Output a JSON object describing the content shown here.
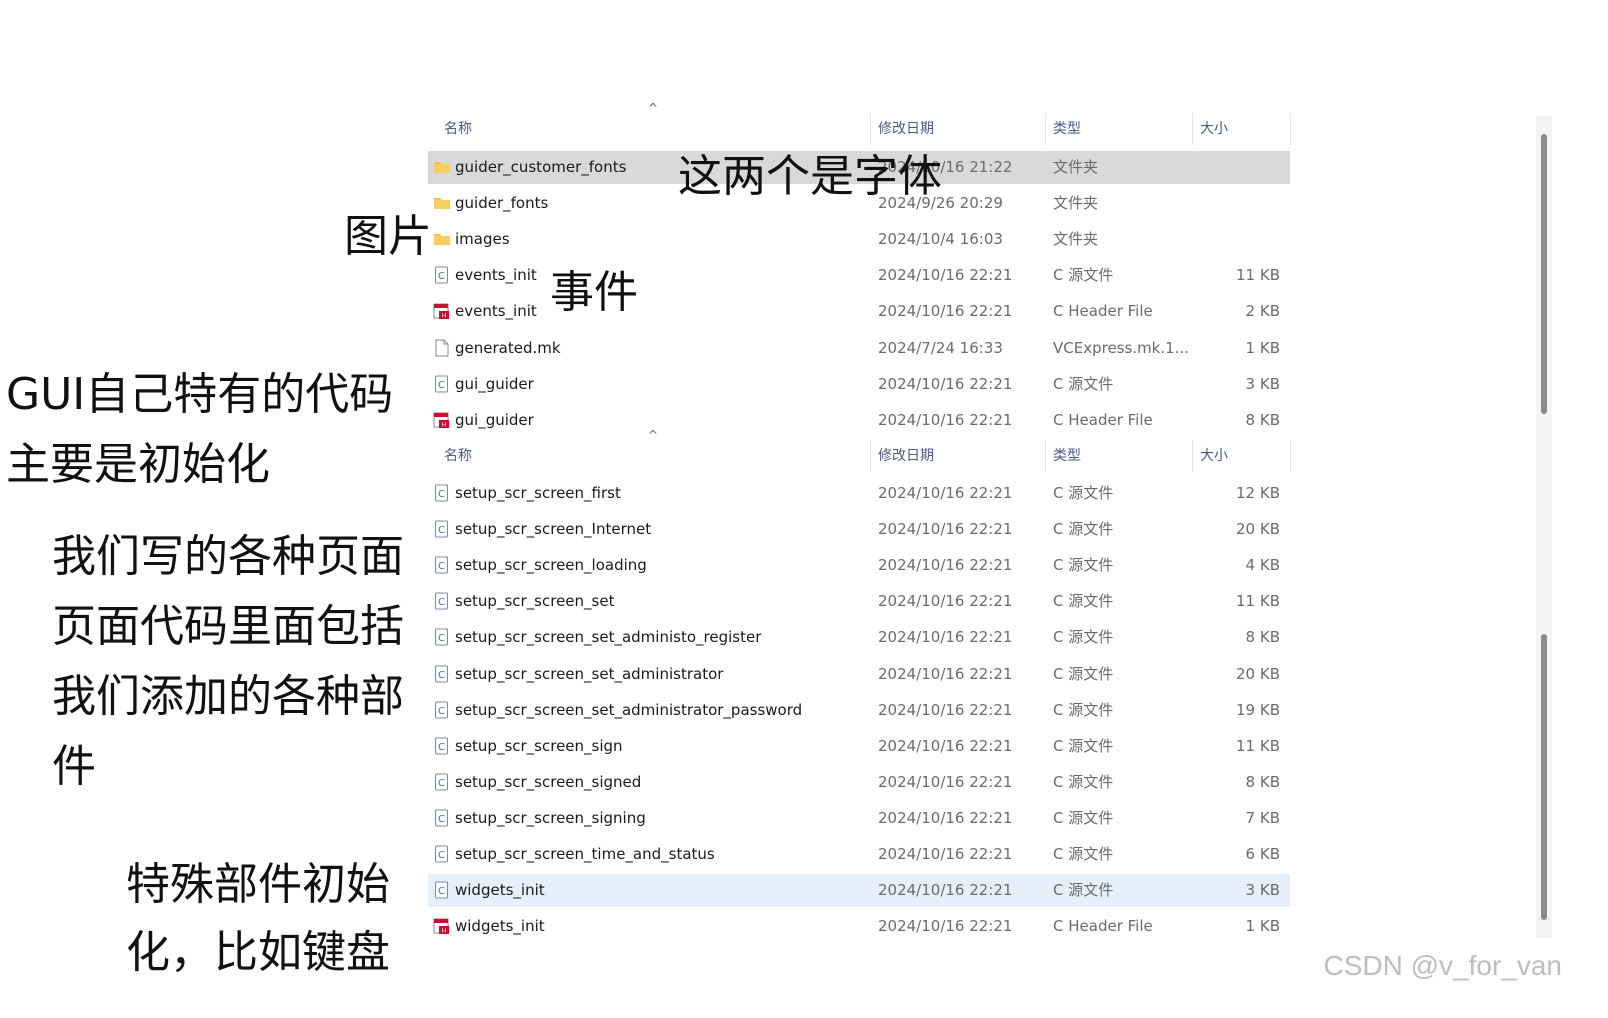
{
  "header": {
    "col_name": "名称",
    "col_date": "修改日期",
    "col_type": "类型",
    "col_size": "大小",
    "sort_caret": "^"
  },
  "files_top": [
    {
      "name": "guider_customer_fonts",
      "date": "2024/10/16 21:22",
      "type": "文件夹",
      "size": "",
      "icon": "folder-icon",
      "state": "selected"
    },
    {
      "name": "guider_fonts",
      "date": "2024/9/26 20:29",
      "type": "文件夹",
      "size": "",
      "icon": "folder-icon"
    },
    {
      "name": "images",
      "date": "2024/10/4 16:03",
      "type": "文件夹",
      "size": "",
      "icon": "folder-icon"
    },
    {
      "name": "events_init",
      "date": "2024/10/16 22:21",
      "type": "C 源文件",
      "size": "11 KB",
      "icon": "c-source-file-icon"
    },
    {
      "name": "events_init",
      "date": "2024/10/16 22:21",
      "type": "C Header File",
      "size": "2 KB",
      "icon": "c-header-file-icon"
    },
    {
      "name": "generated.mk",
      "date": "2024/7/24 16:33",
      "type": "VCExpress.mk.1...",
      "size": "1 KB",
      "icon": "blank-file-icon"
    },
    {
      "name": "gui_guider",
      "date": "2024/10/16 22:21",
      "type": "C 源文件",
      "size": "3 KB",
      "icon": "c-source-file-icon"
    },
    {
      "name": "gui_guider",
      "date": "2024/10/16 22:21",
      "type": "C Header File",
      "size": "8 KB",
      "icon": "c-header-file-icon"
    }
  ],
  "files_bottom": [
    {
      "name": "setup_scr_screen_first",
      "date": "2024/10/16 22:21",
      "type": "C 源文件",
      "size": "12 KB",
      "icon": "c-source-file-icon"
    },
    {
      "name": "setup_scr_screen_Internet",
      "date": "2024/10/16 22:21",
      "type": "C 源文件",
      "size": "20 KB",
      "icon": "c-source-file-icon"
    },
    {
      "name": "setup_scr_screen_loading",
      "date": "2024/10/16 22:21",
      "type": "C 源文件",
      "size": "4 KB",
      "icon": "c-source-file-icon"
    },
    {
      "name": "setup_scr_screen_set",
      "date": "2024/10/16 22:21",
      "type": "C 源文件",
      "size": "11 KB",
      "icon": "c-source-file-icon"
    },
    {
      "name": "setup_scr_screen_set_administo_register",
      "date": "2024/10/16 22:21",
      "type": "C 源文件",
      "size": "8 KB",
      "icon": "c-source-file-icon"
    },
    {
      "name": "setup_scr_screen_set_administrator",
      "date": "2024/10/16 22:21",
      "type": "C 源文件",
      "size": "20 KB",
      "icon": "c-source-file-icon"
    },
    {
      "name": "setup_scr_screen_set_administrator_password",
      "date": "2024/10/16 22:21",
      "type": "C 源文件",
      "size": "19 KB",
      "icon": "c-source-file-icon"
    },
    {
      "name": "setup_scr_screen_sign",
      "date": "2024/10/16 22:21",
      "type": "C 源文件",
      "size": "11 KB",
      "icon": "c-source-file-icon"
    },
    {
      "name": "setup_scr_screen_signed",
      "date": "2024/10/16 22:21",
      "type": "C 源文件",
      "size": "8 KB",
      "icon": "c-source-file-icon"
    },
    {
      "name": "setup_scr_screen_signing",
      "date": "2024/10/16 22:21",
      "type": "C 源文件",
      "size": "7 KB",
      "icon": "c-source-file-icon"
    },
    {
      "name": "setup_scr_screen_time_and_status",
      "date": "2024/10/16 22:21",
      "type": "C 源文件",
      "size": "6 KB",
      "icon": "c-source-file-icon"
    },
    {
      "name": "widgets_init",
      "date": "2024/10/16 22:21",
      "type": "C 源文件",
      "size": "3 KB",
      "icon": "c-source-file-icon",
      "state": "hover"
    },
    {
      "name": "widgets_init",
      "date": "2024/10/16 22:21",
      "type": "C Header File",
      "size": "1 KB",
      "icon": "c-header-file-icon"
    }
  ],
  "annotations": {
    "fonts": "这两个是字体",
    "images": "图片",
    "events": "事件",
    "gui_line1": "GUI自己特有的代码",
    "gui_line2": "主要是初始化",
    "pages_line1": "我们写的各种页面",
    "pages_line2": "页面代码里面包括",
    "pages_line3": "我们添加的各种部",
    "pages_line4": "件",
    "widgets_line1": "特殊部件初始",
    "widgets_line2": "化，比如键盘"
  },
  "watermark": "CSDN @v_for_van",
  "colors": {
    "selected_row": "#d9d9d9",
    "hover_row": "#e6f0fb",
    "header_text": "#4c5a84",
    "folder": "#f2c14e",
    "c_icon": "#3a73b8",
    "h_icon": "#c8102e"
  }
}
